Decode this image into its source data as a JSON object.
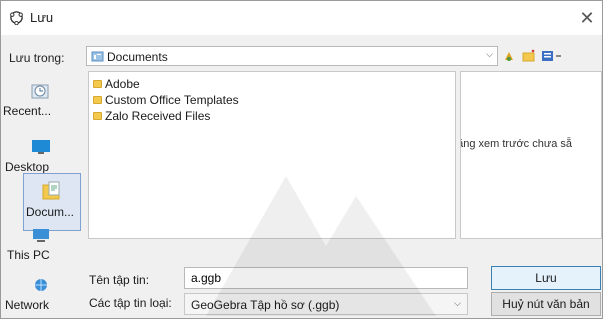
{
  "window": {
    "title": "Lưu"
  },
  "lookin": {
    "label": "Lưu trong:",
    "value": "Documents"
  },
  "places": [
    {
      "label": "Recent...",
      "icon": "recent-icon"
    },
    {
      "label": "Desktop",
      "icon": "desktop-icon"
    },
    {
      "label": "Docum...",
      "icon": "documents-icon"
    },
    {
      "label": "This PC",
      "icon": "this-pc-icon"
    },
    {
      "label": "Network",
      "icon": "network-icon"
    }
  ],
  "files": [
    {
      "name": "Adobe"
    },
    {
      "name": "Custom Office Templates"
    },
    {
      "name": "Zalo Received Files"
    }
  ],
  "preview": {
    "text": "năng xem trước chưa sẵ"
  },
  "filename": {
    "label": "Tên tập tin:",
    "value": "a.ggb"
  },
  "filetype": {
    "label": "Các tập tin loại:",
    "value": "GeoGebra Tập hồ sơ (.ggb)"
  },
  "buttons": {
    "save": "Lưu",
    "cancel": "Huỷ nút văn bản"
  },
  "colors": {
    "accent": "#3c7fb1",
    "folder": "#f2c94c",
    "selection": "#dde6f2"
  }
}
